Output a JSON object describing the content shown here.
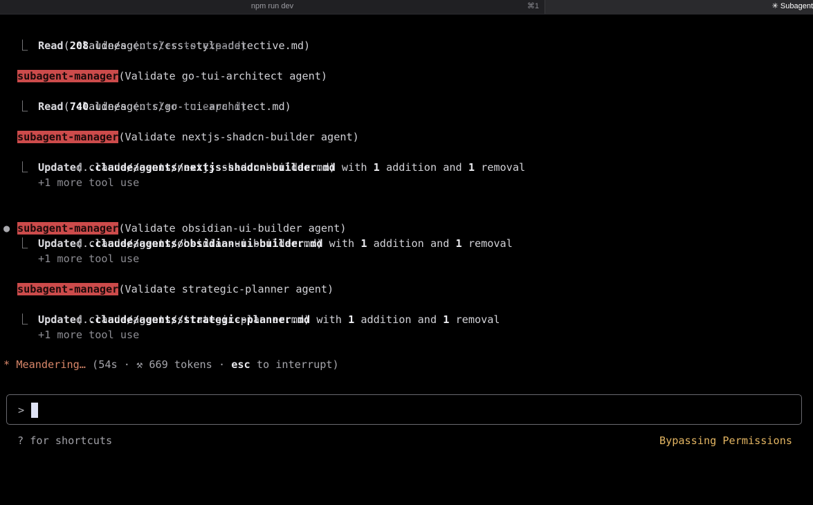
{
  "tabs": {
    "left": {
      "title": "npm run dev",
      "shortcut": "⌘1"
    },
    "right": {
      "title": "✳ Subagent"
    }
  },
  "blocks": [
    {
      "tool_line": {
        "verb": "Read",
        "args": "(.claude/agents/css-style-detective.md)"
      },
      "result": {
        "prefix": "Read ",
        "count": "208",
        "suffix": " lines ",
        "hint": "(ctrl+r to expand)"
      }
    },
    {
      "agent": "subagent-manager",
      "task": "(Validate go-tui-architect agent)",
      "tool_line": {
        "verb": "Read",
        "args": "(.claude/agents/go-tui-architect.md)"
      },
      "result": {
        "prefix": "Read ",
        "count": "740",
        "suffix": " lines ",
        "hint": "(ctrl+r to expand)"
      }
    },
    {
      "agent": "subagent-manager",
      "task": "(Validate nextjs-shadcn-builder agent)",
      "tool_line": {
        "verb": "Update",
        "args": "(.claude/agents/nextjs-shadcn-builder.md)"
      },
      "update": {
        "prefix": "Updated ",
        "file": ".claude/agents/nextjs-shadcn-builder.md",
        "with": " with ",
        "add_count": "1",
        "add_label": " addition and ",
        "rem_count": "1",
        "rem_label": " removal"
      },
      "more": "+1 more tool use"
    },
    {
      "active_bullet": "●",
      "agent": "subagent-manager",
      "task": "(Validate obsidian-ui-builder agent)",
      "tool_line": {
        "verb": "Update",
        "args": "(.claude/agents/obsidian-ui-builder.md)"
      },
      "update": {
        "prefix": "Updated ",
        "file": ".claude/agents/obsidian-ui-builder.md",
        "with": " with ",
        "add_count": "1",
        "add_label": " addition and ",
        "rem_count": "1",
        "rem_label": " removal"
      },
      "more": "+1 more tool use"
    },
    {
      "agent": "subagent-manager",
      "task": "(Validate strategic-planner agent)",
      "tool_line": {
        "verb": "Update",
        "args": "(.claude/agents/strategic-planner.md)"
      },
      "update": {
        "prefix": "Updated ",
        "file": ".claude/agents/strategic-planner.md",
        "with": " with ",
        "add_count": "1",
        "add_label": " addition and ",
        "rem_count": "1",
        "rem_label": " removal"
      },
      "more": "+1 more tool use"
    }
  ],
  "corner_glyph": "⎿",
  "status": {
    "spinner": "*",
    "verb": "Meandering…",
    "open": " (54s · ",
    "hammer": "⚒",
    "tokens": " 669 tokens · ",
    "esc": "esc",
    "close": " to interrupt)"
  },
  "input": {
    "prompt": ">",
    "value": ""
  },
  "footer": {
    "shortcuts": "? for shortcuts",
    "mode": "Bypassing Permissions"
  },
  "colors": {
    "agent_tag_bg": "#cc4b4b",
    "status_accent": "#d9876a",
    "mode_accent": "#e3b562"
  }
}
